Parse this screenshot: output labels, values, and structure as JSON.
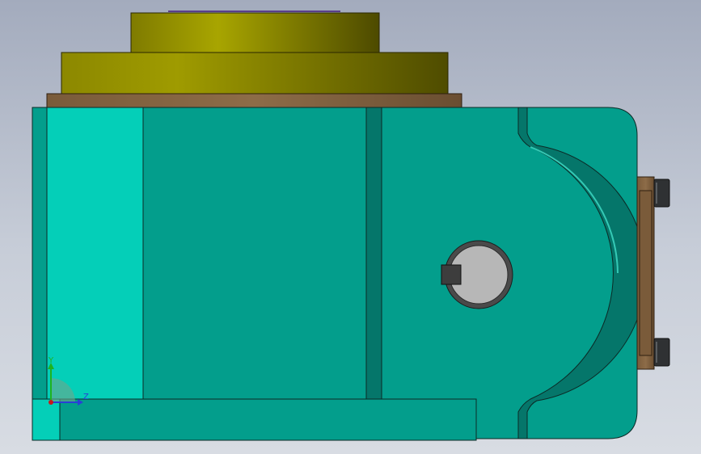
{
  "viewport": {
    "background_top": "#a3abbd",
    "background_bottom": "#d8dce3"
  },
  "colors": {
    "body_teal": "#039e8c",
    "body_dark": "#05766a",
    "light_teal": "#04cfb8",
    "olive": "#a8a500",
    "olive_dark": "#4d4a00",
    "bronze": "#8b6a46",
    "hole_gray": "#b7b7b7",
    "hole_ring": "#4a4a4a",
    "edge": "#0c2a26"
  },
  "triad": {
    "y_label": "Y",
    "z_label": "Z",
    "y_color": "#1fb31f",
    "z_color": "#2a3fd6",
    "x_color": "#c91a1a"
  }
}
